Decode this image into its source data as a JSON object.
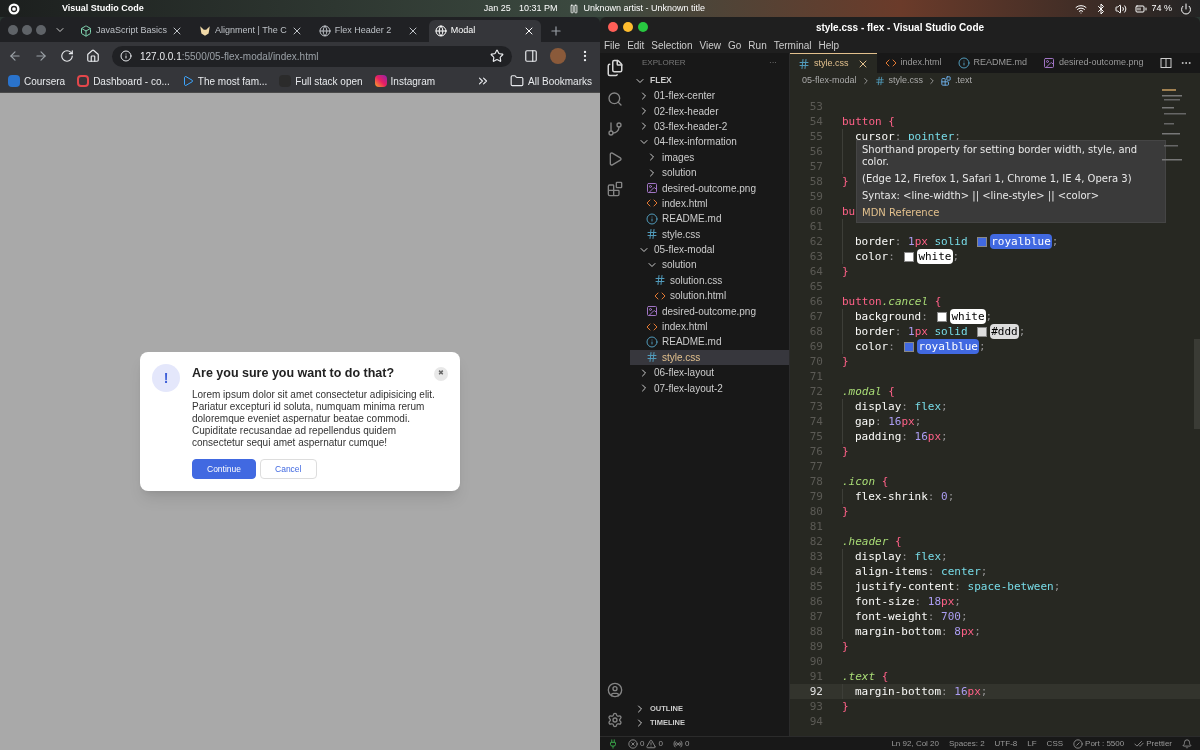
{
  "top_bar": {
    "app": "Visual Studio Code",
    "date": "Jan 25",
    "time": "10:31 PM",
    "media": "Unknown artist - Unknown title",
    "battery": "74 %"
  },
  "browser": {
    "tabs": [
      {
        "title": "JavaScript Basics",
        "selected": false,
        "kind": "app"
      },
      {
        "title": "Alignment | The C",
        "selected": false,
        "kind": "fox"
      },
      {
        "title": "Flex Header 2",
        "selected": false,
        "kind": "globe"
      },
      {
        "title": "Modal",
        "selected": true,
        "kind": "globe"
      }
    ],
    "url_host": "127.0.0.1",
    "url_path": ":5500/05-flex-modal/index.html",
    "bookmarks": [
      {
        "label": "Coursera",
        "kind": "c-blue"
      },
      {
        "label": "Dashboard - co...",
        "kind": "c-red"
      },
      {
        "label": "The most fam...",
        "kind": "play"
      },
      {
        "label": "Full stack open",
        "kind": "dark"
      },
      {
        "label": "Instagram",
        "kind": "insta"
      }
    ],
    "all_bookmarks": "All Bookmarks",
    "modal": {
      "icon": "!",
      "title": "Are you sure you want to do that?",
      "close": "✖",
      "text": "Lorem ipsum dolor sit amet consectetur adipisicing elit. Pariatur excepturi id soluta, numquam minima rerum doloremque eveniet aspernatur beatae commodi. Cupiditate recusandae ad repellendus quidem consectetur sequi amet aspernatur cumque!",
      "buttons": [
        {
          "label": "Continue",
          "kind": "primary"
        },
        {
          "label": "Cancel",
          "kind": "secondary"
        }
      ]
    }
  },
  "vscode": {
    "title": "style.css - flex - Visual Studio Code",
    "menu": [
      "File",
      "Edit",
      "Selection",
      "View",
      "Go",
      "Run",
      "Terminal",
      "Help"
    ],
    "explorer": {
      "title": "EXPLORER",
      "more": "···",
      "root": "FLEX",
      "tree": [
        {
          "name": "01-flex-center",
          "kind": "folder",
          "expanded": false,
          "selected": false
        },
        {
          "name": "02-flex-header",
          "kind": "folder",
          "expanded": false,
          "selected": false
        },
        {
          "name": "03-flex-header-2",
          "kind": "folder",
          "expanded": false,
          "selected": false
        },
        {
          "name": "04-flex-information",
          "kind": "folder",
          "expanded": true,
          "selected": false,
          "children": [
            {
              "name": "images",
              "kind": "folder",
              "expanded": false,
              "selected": false
            },
            {
              "name": "solution",
              "kind": "folder",
              "expanded": false,
              "selected": false
            },
            {
              "name": "desired-outcome.png",
              "kind": "png",
              "selected": false
            },
            {
              "name": "index.html",
              "kind": "html",
              "selected": false
            },
            {
              "name": "README.md",
              "kind": "md",
              "selected": false
            },
            {
              "name": "style.css",
              "kind": "css",
              "selected": false
            }
          ]
        },
        {
          "name": "05-flex-modal",
          "kind": "folder",
          "expanded": true,
          "selected": false,
          "children": [
            {
              "name": "solution",
              "kind": "folder",
              "expanded": true,
              "selected": false,
              "children": [
                {
                  "name": "solution.css",
                  "kind": "css",
                  "selected": false
                },
                {
                  "name": "solution.html",
                  "kind": "html",
                  "selected": false
                }
              ]
            },
            {
              "name": "desired-outcome.png",
              "kind": "png",
              "selected": false
            },
            {
              "name": "index.html",
              "kind": "html",
              "selected": false
            },
            {
              "name": "README.md",
              "kind": "md",
              "selected": false
            },
            {
              "name": "style.css",
              "kind": "css",
              "selected": true
            }
          ]
        },
        {
          "name": "06-flex-layout",
          "kind": "folder",
          "expanded": false,
          "selected": false
        },
        {
          "name": "07-flex-layout-2",
          "kind": "folder",
          "expanded": false,
          "selected": false
        }
      ],
      "panels": [
        "OUTLINE",
        "TIMELINE"
      ]
    },
    "tabs": [
      {
        "name": "style.css",
        "kind": "css",
        "selected": true
      },
      {
        "name": "index.html",
        "kind": "html",
        "selected": false
      },
      {
        "name": "README.md",
        "kind": "md",
        "selected": false
      },
      {
        "name": "desired-outcome.png",
        "kind": "png",
        "selected": false
      }
    ],
    "breadcrumb": {
      "folder": "05-flex-modal",
      "file": "style.css",
      "symbol": ".text"
    },
    "lines": [
      {
        "n": "53",
        "indented": false,
        "current": false
      },
      {
        "n": "54",
        "indented": false,
        "current": false,
        "tokens": [
          {
            "t": "button",
            "kind": "sel"
          },
          {
            "t": " {",
            "kind": "brace"
          }
        ]
      },
      {
        "n": "55",
        "indented": true,
        "current": false,
        "tokens": [
          {
            "t": "cursor",
            "kind": "prop"
          },
          {
            "t": ": ",
            "kind": "punct"
          },
          {
            "t": "pointer",
            "kind": "kw"
          },
          {
            "t": ";",
            "kind": "punct"
          }
        ]
      },
      {
        "n": "56",
        "indented": true,
        "current": false
      },
      {
        "n": "57",
        "indented": true,
        "current": false
      },
      {
        "n": "58",
        "indented": false,
        "current": false,
        "tokens": [
          {
            "t": "}",
            "kind": "brace"
          }
        ]
      },
      {
        "n": "59",
        "indented": false,
        "current": false
      },
      {
        "n": "60",
        "indented": false,
        "current": false,
        "tokens": [
          {
            "t": "bu",
            "kind": "sel"
          }
        ]
      },
      {
        "n": "61",
        "indented": true,
        "current": false
      },
      {
        "n": "62",
        "indented": true,
        "current": false,
        "tokens": [
          {
            "t": "border",
            "kind": "prop"
          },
          {
            "t": ": ",
            "kind": "punct"
          },
          {
            "t": "1",
            "kind": "num"
          },
          {
            "t": "px",
            "kind": "unit"
          },
          {
            "t": " solid ",
            "kind": "kw"
          },
          {
            "t": "royalblue",
            "kind": "color",
            "color": "#4169e1"
          },
          {
            "t": ";",
            "kind": "punct"
          }
        ]
      },
      {
        "n": "63",
        "indented": true,
        "current": false,
        "tokens": [
          {
            "t": "color",
            "kind": "prop"
          },
          {
            "t": ": ",
            "kind": "punct"
          },
          {
            "t": "white",
            "kind": "color",
            "color": "#ffffff"
          },
          {
            "t": ";",
            "kind": "punct"
          }
        ]
      },
      {
        "n": "64",
        "indented": false,
        "current": false,
        "tokens": [
          {
            "t": "}",
            "kind": "brace"
          }
        ]
      },
      {
        "n": "65",
        "indented": false,
        "current": false
      },
      {
        "n": "66",
        "indented": false,
        "current": false,
        "tokens": [
          {
            "t": "button",
            "kind": "sel"
          },
          {
            "t": ".cancel",
            "kind": "cls"
          },
          {
            "t": " {",
            "kind": "brace"
          }
        ]
      },
      {
        "n": "67",
        "indented": true,
        "current": false,
        "tokens": [
          {
            "t": "background",
            "kind": "prop"
          },
          {
            "t": ": ",
            "kind": "punct"
          },
          {
            "t": "white",
            "kind": "color",
            "color": "#ffffff"
          },
          {
            "t": ";",
            "kind": "punct"
          }
        ]
      },
      {
        "n": "68",
        "indented": true,
        "current": false,
        "tokens": [
          {
            "t": "border",
            "kind": "prop"
          },
          {
            "t": ": ",
            "kind": "punct"
          },
          {
            "t": "1",
            "kind": "num"
          },
          {
            "t": "px",
            "kind": "unit"
          },
          {
            "t": " solid ",
            "kind": "kw"
          },
          {
            "t": "#ddd",
            "kind": "color",
            "color": "#dddddd"
          },
          {
            "t": ";",
            "kind": "punct"
          }
        ]
      },
      {
        "n": "69",
        "indented": true,
        "current": false,
        "tokens": [
          {
            "t": "color",
            "kind": "prop"
          },
          {
            "t": ": ",
            "kind": "punct"
          },
          {
            "t": "royalblue",
            "kind": "color",
            "color": "#4169e1"
          },
          {
            "t": ";",
            "kind": "punct"
          }
        ]
      },
      {
        "n": "70",
        "indented": false,
        "current": false,
        "tokens": [
          {
            "t": "}",
            "kind": "brace"
          }
        ]
      },
      {
        "n": "71",
        "indented": false,
        "current": false
      },
      {
        "n": "72",
        "indented": false,
        "current": false,
        "tokens": [
          {
            "t": ".modal",
            "kind": "cls"
          },
          {
            "t": " {",
            "kind": "brace"
          }
        ]
      },
      {
        "n": "73",
        "indented": true,
        "current": false,
        "tokens": [
          {
            "t": "display",
            "kind": "prop"
          },
          {
            "t": ": ",
            "kind": "punct"
          },
          {
            "t": "flex",
            "kind": "kw"
          },
          {
            "t": ";",
            "kind": "punct"
          }
        ]
      },
      {
        "n": "74",
        "indented": true,
        "current": false,
        "tokens": [
          {
            "t": "gap",
            "kind": "prop"
          },
          {
            "t": ": ",
            "kind": "punct"
          },
          {
            "t": "16",
            "kind": "num"
          },
          {
            "t": "px",
            "kind": "unit"
          },
          {
            "t": ";",
            "kind": "punct"
          }
        ]
      },
      {
        "n": "75",
        "indented": true,
        "current": false,
        "tokens": [
          {
            "t": "padding",
            "kind": "prop"
          },
          {
            "t": ": ",
            "kind": "punct"
          },
          {
            "t": "16",
            "kind": "num"
          },
          {
            "t": "px",
            "kind": "unit"
          },
          {
            "t": ";",
            "kind": "punct"
          }
        ]
      },
      {
        "n": "76",
        "indented": false,
        "current": false,
        "tokens": [
          {
            "t": "}",
            "kind": "brace"
          }
        ]
      },
      {
        "n": "77",
        "indented": false,
        "current": false
      },
      {
        "n": "78",
        "indented": false,
        "current": false,
        "tokens": [
          {
            "t": ".icon",
            "kind": "cls"
          },
          {
            "t": " {",
            "kind": "brace"
          }
        ]
      },
      {
        "n": "79",
        "indented": true,
        "current": false,
        "tokens": [
          {
            "t": "flex-shrink",
            "kind": "prop"
          },
          {
            "t": ": ",
            "kind": "punct"
          },
          {
            "t": "0",
            "kind": "num"
          },
          {
            "t": ";",
            "kind": "punct"
          }
        ]
      },
      {
        "n": "80",
        "indented": false,
        "current": false,
        "tokens": [
          {
            "t": "}",
            "kind": "brace"
          }
        ]
      },
      {
        "n": "81",
        "indented": false,
        "current": false
      },
      {
        "n": "82",
        "indented": false,
        "current": false,
        "tokens": [
          {
            "t": ".header",
            "kind": "cls"
          },
          {
            "t": " {",
            "kind": "brace"
          }
        ]
      },
      {
        "n": "83",
        "indented": true,
        "current": false,
        "tokens": [
          {
            "t": "display",
            "kind": "prop"
          },
          {
            "t": ": ",
            "kind": "punct"
          },
          {
            "t": "flex",
            "kind": "kw"
          },
          {
            "t": ";",
            "kind": "punct"
          }
        ]
      },
      {
        "n": "84",
        "indented": true,
        "current": false,
        "tokens": [
          {
            "t": "align-items",
            "kind": "prop"
          },
          {
            "t": ": ",
            "kind": "punct"
          },
          {
            "t": "center",
            "kind": "kw"
          },
          {
            "t": ";",
            "kind": "punct"
          }
        ]
      },
      {
        "n": "85",
        "indented": true,
        "current": false,
        "tokens": [
          {
            "t": "justify-content",
            "kind": "prop"
          },
          {
            "t": ": ",
            "kind": "punct"
          },
          {
            "t": "space-between",
            "kind": "kw"
          },
          {
            "t": ";",
            "kind": "punct"
          }
        ]
      },
      {
        "n": "86",
        "indented": true,
        "current": false,
        "tokens": [
          {
            "t": "font-size",
            "kind": "prop"
          },
          {
            "t": ": ",
            "kind": "punct"
          },
          {
            "t": "18",
            "kind": "num"
          },
          {
            "t": "px",
            "kind": "unit"
          },
          {
            "t": ";",
            "kind": "punct"
          }
        ]
      },
      {
        "n": "87",
        "indented": true,
        "current": false,
        "tokens": [
          {
            "t": "font-weight",
            "kind": "prop"
          },
          {
            "t": ": ",
            "kind": "punct"
          },
          {
            "t": "700",
            "kind": "num"
          },
          {
            "t": ";",
            "kind": "punct"
          }
        ]
      },
      {
        "n": "88",
        "indented": true,
        "current": false,
        "tokens": [
          {
            "t": "margin-bottom",
            "kind": "prop"
          },
          {
            "t": ": ",
            "kind": "punct"
          },
          {
            "t": "8",
            "kind": "num"
          },
          {
            "t": "px",
            "kind": "unit"
          },
          {
            "t": ";",
            "kind": "punct"
          }
        ]
      },
      {
        "n": "89",
        "indented": false,
        "current": false,
        "tokens": [
          {
            "t": "}",
            "kind": "brace"
          }
        ]
      },
      {
        "n": "90",
        "indented": false,
        "current": false
      },
      {
        "n": "91",
        "indented": false,
        "current": false,
        "tokens": [
          {
            "t": ".text",
            "kind": "cls"
          },
          {
            "t": " {",
            "kind": "brace"
          }
        ]
      },
      {
        "n": "92",
        "indented": true,
        "current": true,
        "tokens": [
          {
            "t": "margin-bottom",
            "kind": "prop"
          },
          {
            "t": ": ",
            "kind": "punct"
          },
          {
            "t": "16",
            "kind": "num"
          },
          {
            "t": "px",
            "kind": "unit"
          },
          {
            "t": ";",
            "kind": "punct"
          }
        ]
      },
      {
        "n": "93",
        "indented": false,
        "current": false,
        "tokens": [
          {
            "t": "}",
            "kind": "brace"
          }
        ]
      },
      {
        "n": "94",
        "indented": false,
        "current": false
      }
    ],
    "hover": {
      "description": "Shorthand property for setting border width, style, and color.",
      "support": "(Edge 12, Firefox 1, Safari 1, Chrome 1, IE 4, Opera 3)",
      "syntax": "Syntax: <line-width> || <line-style> || <color>",
      "link": "MDN Reference"
    },
    "status": {
      "errors": "0",
      "warnings": "0",
      "ports": "0",
      "position": "Ln 92, Col 20",
      "spaces": "Spaces: 2",
      "encoding": "UTF-8",
      "eol": "LF",
      "language": "CSS",
      "port": "Port : 5500",
      "formatter": "Prettier"
    }
  }
}
